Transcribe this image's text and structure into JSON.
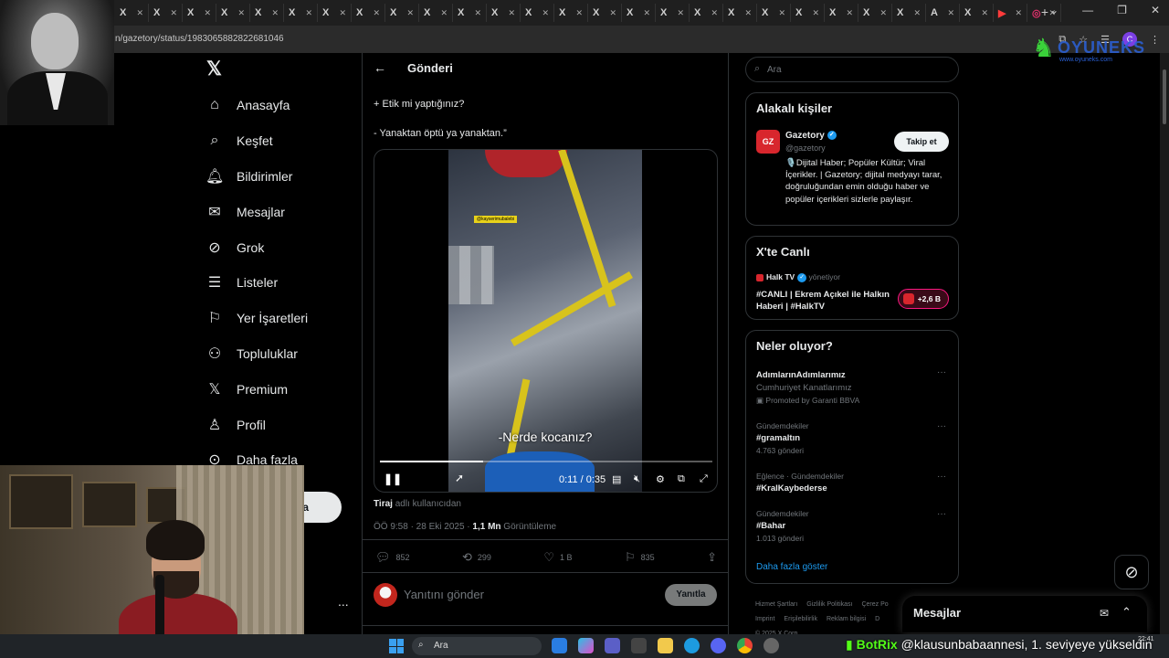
{
  "browser": {
    "tabs": [
      {
        "icon": "X",
        "kind": "x"
      },
      {
        "icon": "X",
        "kind": "x"
      },
      {
        "icon": "X",
        "kind": "x"
      },
      {
        "icon": "X",
        "kind": "x"
      },
      {
        "icon": "X",
        "kind": "x"
      },
      {
        "icon": "X",
        "kind": "x"
      },
      {
        "icon": "X",
        "kind": "x"
      },
      {
        "icon": "X",
        "kind": "x"
      },
      {
        "icon": "X",
        "kind": "x"
      },
      {
        "icon": "X",
        "kind": "x"
      },
      {
        "icon": "X",
        "kind": "x"
      },
      {
        "icon": "X",
        "kind": "x"
      },
      {
        "icon": "X",
        "kind": "x"
      },
      {
        "icon": "X",
        "kind": "x"
      },
      {
        "icon": "X",
        "kind": "x"
      },
      {
        "icon": "X",
        "kind": "x"
      },
      {
        "icon": "X",
        "kind": "x"
      },
      {
        "icon": "X",
        "kind": "x"
      },
      {
        "icon": "X",
        "kind": "x"
      },
      {
        "icon": "X",
        "kind": "x"
      },
      {
        "icon": "X",
        "kind": "x"
      },
      {
        "icon": "X",
        "kind": "x"
      },
      {
        "icon": "X",
        "kind": "x"
      },
      {
        "icon": "X",
        "kind": "x"
      },
      {
        "icon": "A",
        "kind": "a"
      },
      {
        "icon": "X",
        "kind": "x"
      },
      {
        "icon": "▶",
        "kind": "yt"
      },
      {
        "icon": "◎",
        "kind": "ig"
      }
    ],
    "new_tab": "+",
    "url": "n/gazetory/status/1983065882822681046",
    "profile_initial": "C"
  },
  "overlay": {
    "logo_text": "OYUNEKS",
    "logo_sub": "www.oyuneks.com"
  },
  "sidebar": {
    "items": [
      {
        "label": "Anasayfa",
        "icon": "home-icon"
      },
      {
        "label": "Keşfet",
        "icon": "search-icon"
      },
      {
        "label": "Bildirimler",
        "icon": "bell-icon"
      },
      {
        "label": "Mesajlar",
        "icon": "mail-icon"
      },
      {
        "label": "Grok",
        "icon": "grok-icon"
      },
      {
        "label": "Listeler",
        "icon": "list-icon"
      },
      {
        "label": "Yer İşaretleri",
        "icon": "bookmark-icon"
      },
      {
        "label": "Topluluklar",
        "icon": "communities-icon"
      },
      {
        "label": "Premium",
        "icon": "x-premium-icon"
      },
      {
        "label": "Profil",
        "icon": "profile-icon"
      },
      {
        "label": "Daha fazla",
        "icon": "more-circle-icon"
      }
    ],
    "post_button_partial": "a",
    "more_dots": "..."
  },
  "post": {
    "header_title": "Gönderi",
    "lines": [
      "+ Etik mi yaptığınız?",
      "- Yanaktan öptü ya yanaktan.”"
    ],
    "video": {
      "subtitle": "-Nerde kocanız?",
      "overlay_tag": "@kayserimubalebi",
      "time": "0:11 / 0:35",
      "progress": 0.31
    },
    "source_label": "Tiraj",
    "source_suffix": " adlı kullanıcıdan",
    "timestamp": "ÖÖ 9:58 · 28 Eki 2025 · ",
    "views_value": "1,1 Mn",
    "views_suffix": " Görüntüleme",
    "stats": {
      "replies": "852",
      "reposts": "299",
      "likes": "1 B",
      "bookmarks": "835"
    },
    "reply_placeholder": "Yanıtını gönder",
    "reply_button": "Yanıtla"
  },
  "right": {
    "search_placeholder": "Ara",
    "related_title": "Alakalı kişiler",
    "gazetory": {
      "avatar": "GZ",
      "name": "Gazetory",
      "handle": "@gazetory",
      "follow": "Takip et",
      "bio": "🎙️Dijital Haber; Popüler Kültür; Viral İçerikler. | Gazetory; dijital medyayı tarar, doğruluğundan emin olduğu haber ve popüler içerikleri sizlerle paylaşır."
    },
    "live_title": "X'te Canlı",
    "live": {
      "source": "Halk TV",
      "source_suffix": " yönetiyor",
      "title": "#CANLI | Ekrem Açıkel ile Halkın Haberi | #HalkTV",
      "badge": "+2,6 B"
    },
    "trends_title": "Neler oluyor?",
    "trends": [
      {
        "context": "",
        "name": "AdımlarınAdımlarımız",
        "sub": "Cumhuriyet Kanatlarımız",
        "count": "Promoted by Garanti BBVA"
      },
      {
        "context": "Gündemdekiler",
        "name": "#gramaltın",
        "sub": "",
        "count": "4.763 gönderi"
      },
      {
        "context": "Eğlence · Gündemdekiler",
        "name": "#KralKaybederse",
        "sub": "",
        "count": ""
      },
      {
        "context": "Gündemdekiler",
        "name": "#Bahar",
        "sub": "",
        "count": "1.013 gönderi"
      }
    ],
    "show_more": "Daha fazla göster",
    "footer": [
      "Hizmet Şartları",
      "Gizlilik Politikası",
      "Çerez Po",
      "Imprint",
      "Erişilebilirlik",
      "Reklam bilgisi",
      "D",
      "© 2025 X Corp."
    ],
    "messages_label": "Mesajlar"
  },
  "taskbar": {
    "search_placeholder": "Ara",
    "botrix_name": "BotRix",
    "botrix_msg": " @klausunbabaannesi, 1. seviyeye yükseldin",
    "time": "22:41"
  },
  "colors": {
    "accent": "#1d9bf0",
    "brand_red": "#d8262d",
    "live_pink": "#f91880"
  }
}
